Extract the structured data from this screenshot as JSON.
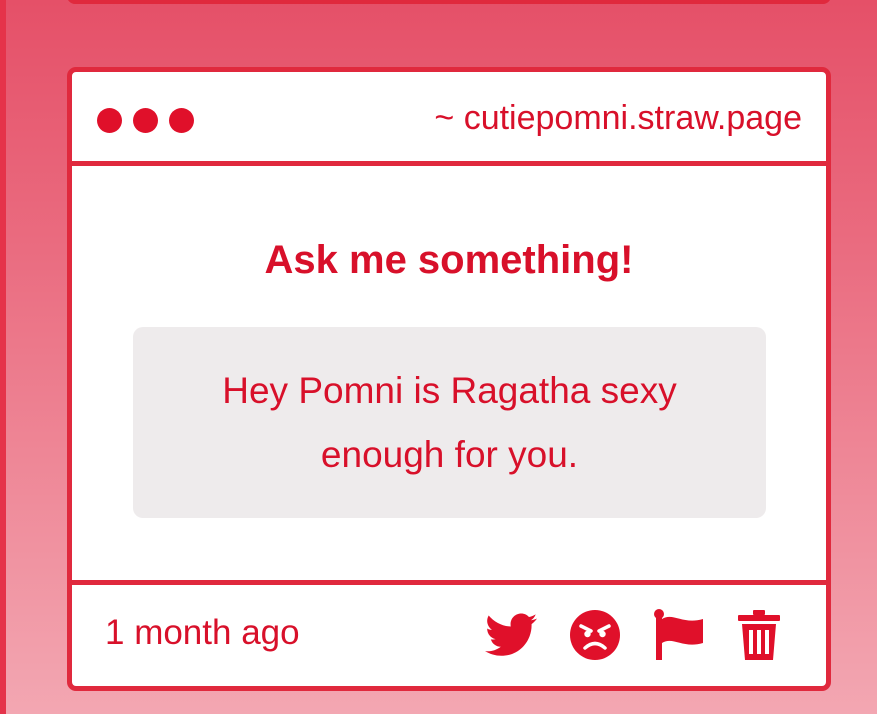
{
  "window": {
    "url": "~ cutiepomni.straw.page"
  },
  "card": {
    "heading": "Ask me something!",
    "question": "Hey Pomni is Ragatha sexy enough for you.",
    "timestamp": "1 month ago"
  },
  "actions": [
    {
      "icon": "twitter-icon"
    },
    {
      "icon": "angry-face-icon"
    },
    {
      "icon": "flag-icon"
    },
    {
      "icon": "trash-icon"
    }
  ],
  "colors": {
    "accent": "#e0102a",
    "border": "#e0293d",
    "question_bg": "#eeebec"
  }
}
